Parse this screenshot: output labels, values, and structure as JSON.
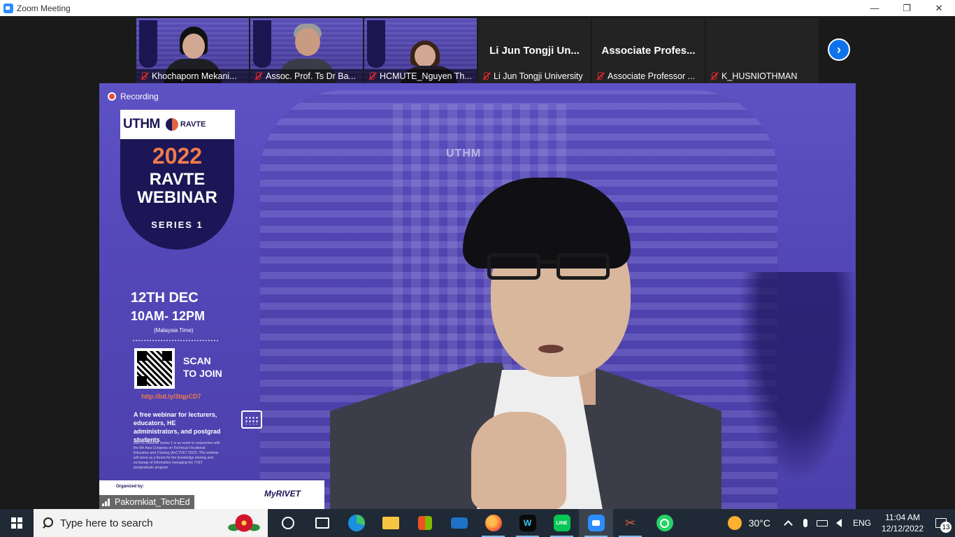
{
  "window": {
    "title": "Zoom Meeting",
    "controls": {
      "minimize": "—",
      "restore": "❐",
      "close": "✕"
    }
  },
  "thumbnails": [
    {
      "name": "Khochaporn Mekani...",
      "video": true
    },
    {
      "name": "Assoc. Prof. Ts Dr Ba...",
      "video": true
    },
    {
      "name": "HCMUTE_Nguyen Th...",
      "video": true
    },
    {
      "name": "Li Jun Tongji University",
      "big_name": "Li Jun Tongji Un...",
      "video": false
    },
    {
      "name": "Associate Professor ...",
      "big_name": "Associate Profes...",
      "video": false
    },
    {
      "name": "K_HUSNIOTHMAN",
      "big_name": "",
      "video": false
    }
  ],
  "next_page_glyph": "›",
  "main": {
    "recording_label": "Recording",
    "speaker_name": "Pakornkiat_TechEd",
    "building_sign": "UTHM",
    "poster": {
      "logo_primary": "UTHM",
      "logo_secondary": "RAVTE",
      "year": "2022",
      "title_line1": "RAVTE",
      "title_line2": "WEBINAR",
      "series": "SERIES 1",
      "date": "12TH DEC",
      "time": "10AM- 12PM",
      "timezone": "(Malaysia Time)",
      "scan_line1": "SCAN",
      "scan_line2": "TO JOIN",
      "link": "http://bit.ly/3tqpCD7",
      "description": "A free webinar for lecturers, educators, HE administrators, and postgrad students",
      "fine_print": "RAVTE Webinar Series 1 is an event in conjunction with the 6th Asia Congress on Technical Vocational Education and Training (AnCTVET 2022). This webinar will serve as a forum for the knowledge sharing and exchange of information managing the TVET postgraduate program",
      "organized_by": "Organized by:",
      "partner": "MyRIVET"
    }
  },
  "taskbar": {
    "search_placeholder": "Type here to search",
    "apps": [
      {
        "id": "cortana-icon"
      },
      {
        "id": "task-view-icon"
      },
      {
        "id": "edge-icon"
      },
      {
        "id": "file-explorer-icon"
      },
      {
        "id": "store-icon"
      },
      {
        "id": "mail-icon"
      },
      {
        "id": "firefox-icon"
      },
      {
        "id": "webex-icon",
        "glyph": "W"
      },
      {
        "id": "line-icon",
        "glyph": "LINE"
      },
      {
        "id": "zoom-icon"
      },
      {
        "id": "snipping-tool-icon",
        "glyph": "✂"
      },
      {
        "id": "whatsapp-icon"
      }
    ],
    "weather": "30°C",
    "language": "ENG",
    "time": "11:04 AM",
    "date": "12/12/2022",
    "notification_count": "13"
  }
}
